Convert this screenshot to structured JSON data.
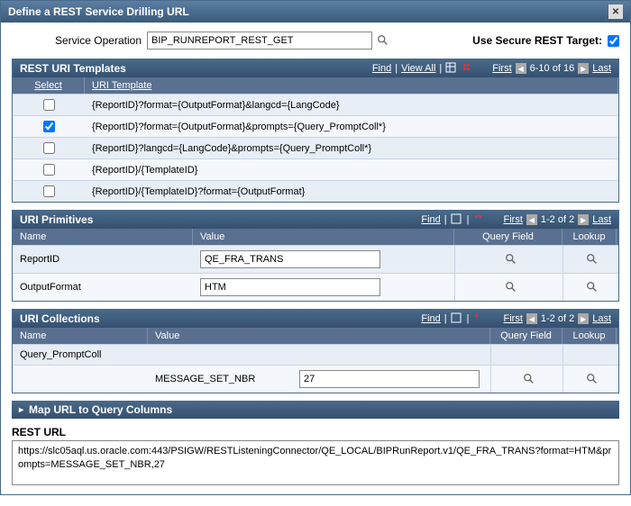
{
  "dialog": {
    "title": "Define a REST Service Drilling URL"
  },
  "top": {
    "service_label": "Service Operation",
    "service_value": "BIP_RUNREPORT_REST_GET",
    "secure_label": "Use Secure REST Target:",
    "secure_checked": true
  },
  "templates": {
    "title": "REST URI Templates",
    "links": {
      "find": "Find",
      "view_all": "View All"
    },
    "nav": {
      "first": "First",
      "range": "6-10 of 16",
      "last": "Last"
    },
    "cols": {
      "select": "Select",
      "uri": "URI Template"
    },
    "rows": [
      {
        "checked": false,
        "uri": "{ReportID}?format={OutputFormat}&langcd={LangCode}"
      },
      {
        "checked": true,
        "uri": "{ReportID}?format={OutputFormat}&prompts={Query_PromptColl*}"
      },
      {
        "checked": false,
        "uri": "{ReportID}?langcd={LangCode}&prompts={Query_PromptColl*}"
      },
      {
        "checked": false,
        "uri": "{ReportID}/{TemplateID}"
      },
      {
        "checked": false,
        "uri": "{ReportID}/{TemplateID}?format={OutputFormat}"
      }
    ]
  },
  "primitives": {
    "title": "URI Primitives",
    "links": {
      "find": "Find"
    },
    "nav": {
      "first": "First",
      "range": "1-2 of 2",
      "last": "Last"
    },
    "cols": {
      "name": "Name",
      "value": "Value",
      "qf": "Query Field",
      "lookup": "Lookup"
    },
    "rows": [
      {
        "name": "ReportID",
        "value": "QE_FRA_TRANS"
      },
      {
        "name": "OutputFormat",
        "value": "HTM"
      }
    ]
  },
  "collections": {
    "title": "URI Collections",
    "links": {
      "find": "Find"
    },
    "nav": {
      "first": "First",
      "range": "1-2 of 2",
      "last": "Last"
    },
    "cols": {
      "name": "Name",
      "value": "Value",
      "qf": "Query Field",
      "lookup": "Lookup"
    },
    "rows": [
      {
        "name": "Query_PromptColl",
        "msg": "",
        "value": ""
      },
      {
        "name": "",
        "msg": "MESSAGE_SET_NBR",
        "value": "27"
      }
    ]
  },
  "expand": {
    "label": "Map URL to Query Columns"
  },
  "resturl": {
    "label": "REST URL",
    "value": "https://slc05aql.us.oracle.com:443/PSIGW/RESTListeningConnector/QE_LOCAL/BIPRunReport.v1/QE_FRA_TRANS?format=HTM&prompts=MESSAGE_SET_NBR,27"
  }
}
